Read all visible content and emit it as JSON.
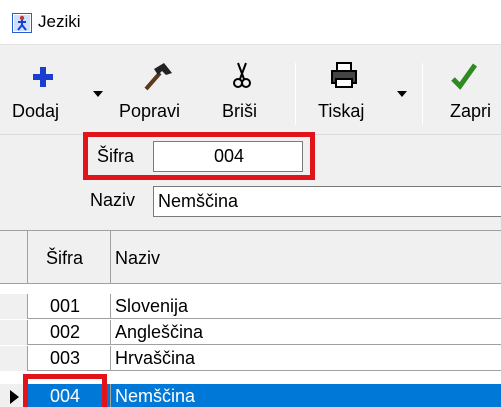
{
  "window": {
    "title": "Jeziki"
  },
  "toolbar": {
    "add_label": "Dodaj",
    "edit_label": "Popravi",
    "delete_label": "Briši",
    "print_label": "Tiskaj",
    "close_label": "Zapri"
  },
  "form": {
    "code_label": "Šifra",
    "code_value": "004",
    "name_label": "Naziv",
    "name_value": "Nemščina"
  },
  "grid": {
    "columns": [
      "Šifra",
      "Naziv"
    ],
    "rows": [
      {
        "code": "001",
        "name": "Slovenija"
      },
      {
        "code": "002",
        "name": "Angleščina"
      },
      {
        "code": "003",
        "name": "Hrvaščina"
      },
      {
        "code": "004",
        "name": "Nemščina"
      }
    ],
    "selected_index": 3
  },
  "colors": {
    "highlight": "#e2141b",
    "selection": "#0078d7",
    "check": "#2e8b20",
    "add": "#1a3fd0"
  }
}
